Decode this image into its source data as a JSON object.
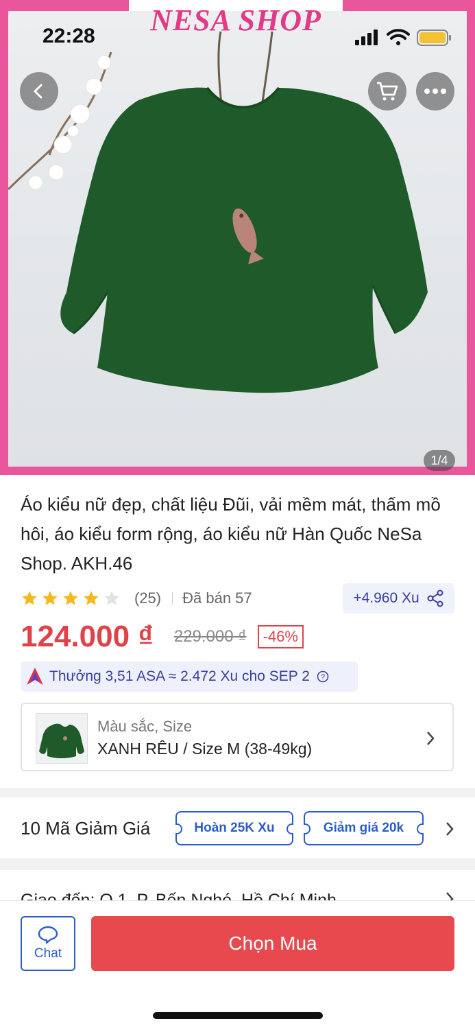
{
  "status_bar": {
    "time": "22:28"
  },
  "hero": {
    "brand": "NESA SHOP",
    "page_indicator": "1/4",
    "icons": [
      "back-icon",
      "cart-icon",
      "more-icon"
    ]
  },
  "product": {
    "title": "Áo kiểu nữ đẹp, chất liệu Đũi, vải mềm mát, thấm mồ hôi, áo kiểu form rộng, áo kiểu nữ Hàn Quốc NeSa Shop. AKH.46",
    "rating": 4,
    "rating_max": 5,
    "review_count": "(25)",
    "sold": "Đã bán 57",
    "xu_reward": "+4.960 Xu",
    "price": "124.000 ₫",
    "old_price": "229.000 ₫",
    "discount": "-46%",
    "asa_reward": "Thưởng 3,51 ASA ≈ 2.472 Xu cho SEP 2"
  },
  "variant": {
    "label": "Màu sắc, Size",
    "value": "XANH RÊU / Size M (38-49kg)"
  },
  "vouchers": {
    "title": "10 Mã Giảm Giá",
    "coupons": [
      "Hoàn 25K Xu",
      "Giảm giá 20k"
    ]
  },
  "shipping": {
    "text": "Giao đến: Q.1, P. Bến Nghé, Hồ Chí Minh"
  },
  "bottom_bar": {
    "chat_label": "Chat",
    "buy_label": "Chọn Mua"
  },
  "colors": {
    "brand_pink": "#e9569b",
    "price_red": "#e0424a",
    "link_blue": "#2b5dc9",
    "buy_button": "#e8494e",
    "shirt_green": "#1f5a2a"
  }
}
